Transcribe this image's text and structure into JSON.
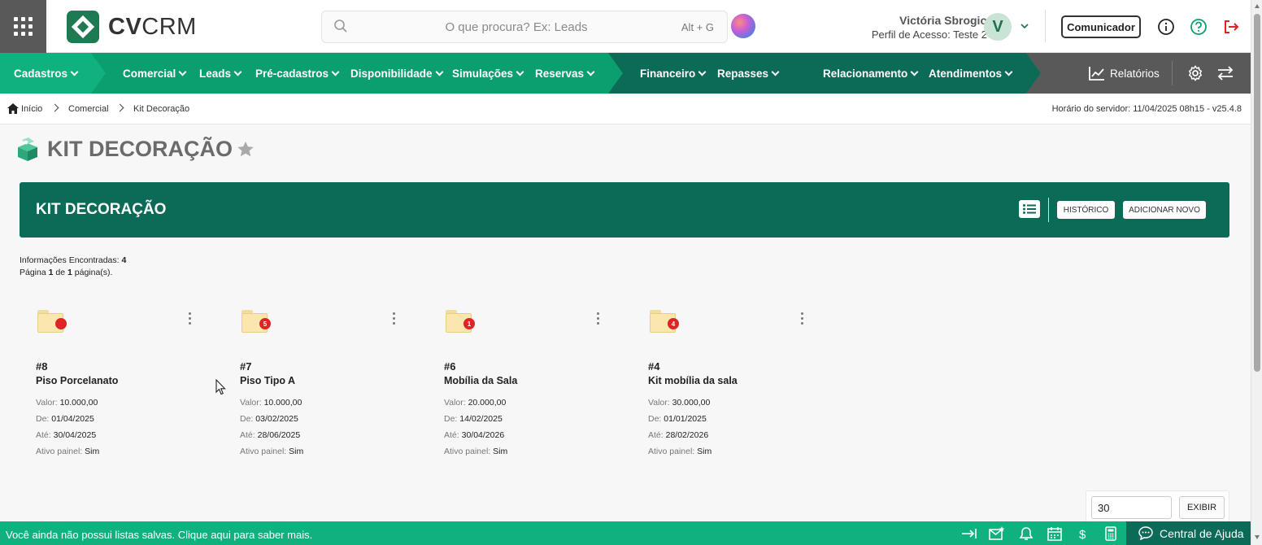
{
  "header": {
    "logo_text_bold": "CV",
    "logo_text_light": "CRM",
    "search_placeholder": "O que procura? Ex: Leads",
    "search_shortcut": "Alt + G",
    "user_name": "Victória Sbrogio",
    "user_profile": "Perfil de Acesso: Teste 2",
    "avatar_letter": "V",
    "comunicador_label": "Comunicador"
  },
  "nav": {
    "items": [
      {
        "label": "Cadastros"
      },
      {
        "label": "Comercial"
      },
      {
        "label": "Leads"
      },
      {
        "label": "Pré-cadastros"
      },
      {
        "label": "Disponibilidade"
      },
      {
        "label": "Simulações"
      },
      {
        "label": "Reservas"
      },
      {
        "label": "Financeiro"
      },
      {
        "label": "Repasses"
      },
      {
        "label": "Relacionamento"
      },
      {
        "label": "Atendimentos"
      }
    ],
    "reports_label": "Relatórios"
  },
  "breadcrumb": {
    "items": [
      "Início",
      "Comercial",
      "Kit Decoração"
    ],
    "server_time": "Horário do servidor: 11/04/2025 08h15 - v25.4.8"
  },
  "page": {
    "title": "KIT DECORAÇÃO",
    "banner_title": "KIT DECORAÇÃO",
    "history_label": "HISTÓRICO",
    "add_new_label": "ADICIONAR NOVO",
    "info_found_label": "Informações Encontradas:",
    "info_found_count": "4",
    "page_prefix": "Página",
    "page_current": "1",
    "page_of": "de",
    "page_total": "1",
    "page_suffix": "página(s)."
  },
  "field_labels": {
    "valor": "Valor:",
    "de": "De:",
    "ate": "Até:",
    "ativo": "Ativo painel:"
  },
  "cards": [
    {
      "num": "#8",
      "name": "Piso Porcelanato",
      "badge": "",
      "valor": "10.000,00",
      "de": "01/04/2025",
      "ate": "30/04/2025",
      "ativo": "Sim"
    },
    {
      "num": "#7",
      "name": "Piso Tipo A",
      "badge": "5",
      "valor": "10.000,00",
      "de": "03/02/2025",
      "ate": "28/06/2025",
      "ativo": "Sim"
    },
    {
      "num": "#6",
      "name": "Mobília da Sala",
      "badge": "1",
      "valor": "20.000,00",
      "de": "14/02/2025",
      "ate": "30/04/2026",
      "ativo": "Sim"
    },
    {
      "num": "#4",
      "name": "Kit mobília da sala",
      "badge": "4",
      "valor": "30.000,00",
      "de": "01/01/2025",
      "ate": "28/02/2026",
      "ativo": "Sim"
    }
  ],
  "pager": {
    "per_page": "30",
    "show_label": "EXIBIR"
  },
  "footer": {
    "message": "Você ainda não possui listas salvas. Clique aqui para saber mais.",
    "help_label": "Central de Ajuda"
  },
  "colors": {
    "nav_green": "#0b9f70",
    "nav_dark": "#0b6b56",
    "nav_gray": "#595959",
    "footer_green": "#0fb27e",
    "badge_red": "#e02424"
  }
}
